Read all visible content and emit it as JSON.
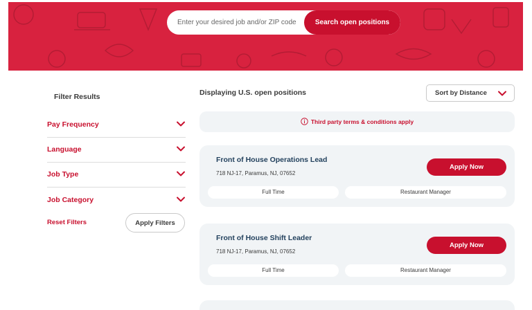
{
  "search": {
    "placeholder": "Enter your desired job and/or ZIP code",
    "button_label": "Search open positions"
  },
  "filters": {
    "title": "Filter Results",
    "items": [
      {
        "label": "Pay Frequency"
      },
      {
        "label": "Language"
      },
      {
        "label": "Job Type"
      },
      {
        "label": "Job Category"
      }
    ],
    "reset_label": "Reset Filters",
    "apply_label": "Apply Filters"
  },
  "results": {
    "heading": "Displaying U.S. open positions",
    "sort_label": "Sort by Distance",
    "terms_notice": "Third party terms & conditions apply"
  },
  "jobs": [
    {
      "title": "Front of House Operations Lead",
      "address": "718 NJ-17, Paramus, NJ, 07652",
      "apply_label": "Apply Now",
      "job_type": "Full Time",
      "category": "Restaurant Manager"
    },
    {
      "title": "Front of House Shift Leader",
      "address": "718 NJ-17, Paramus, NJ, 07652",
      "apply_label": "Apply Now",
      "job_type": "Full Time",
      "category": "Restaurant Manager"
    }
  ],
  "colors": {
    "brand_red": "#d8223f",
    "button_red": "#c8102e",
    "card_bg": "#f1f4f6",
    "title_navy": "#24425e"
  },
  "icons": {
    "chevron": "chevron-down-icon",
    "info": "info-icon"
  }
}
